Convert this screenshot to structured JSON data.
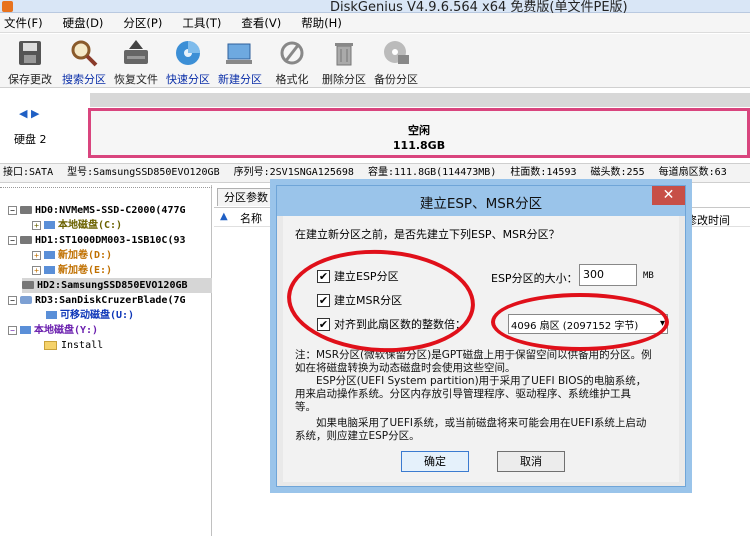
{
  "window": {
    "title": "DiskGenius V4.9.6.564 x64 免费版(单文件PE版)"
  },
  "menu": {
    "items": [
      "文件(F)",
      "硬盘(D)",
      "分区(P)",
      "工具(T)",
      "查看(V)",
      "帮助(H)"
    ]
  },
  "toolbar": {
    "items": [
      {
        "label": "保存更改",
        "icon": "save-icon"
      },
      {
        "label": "搜索分区",
        "icon": "search-icon"
      },
      {
        "label": "恢复文件",
        "icon": "recover-icon"
      },
      {
        "label": "快速分区",
        "icon": "quick-partition-icon"
      },
      {
        "label": "新建分区",
        "icon": "new-partition-icon"
      },
      {
        "label": "格式化",
        "icon": "format-icon"
      },
      {
        "label": "删除分区",
        "icon": "trash-icon"
      },
      {
        "label": "备份分区",
        "icon": "backup-icon"
      }
    ]
  },
  "disk_map": {
    "nav": "◀ ▶",
    "disk_label": "硬盘 2",
    "partition_name": "空闲",
    "partition_size": "111.8GB"
  },
  "infobar": {
    "interface": "接口:SATA",
    "model": "型号:SamsungSSD850EVO120GB",
    "serial": "序列号:2SV1SNGA125698",
    "capacity": "容量:111.8GB(114473MB)",
    "cylinders": "柱面数:14593",
    "heads": "磁头数:255",
    "sectors": "每道扇区数:63"
  },
  "tree": {
    "items": [
      {
        "expander": "−",
        "icon": "disk",
        "text": "HD0:NVMeMS-SSD-C2000(477G",
        "color": "default"
      },
      {
        "expander": "+",
        "icon": "part",
        "text": "本地磁盘(C:)",
        "color": "olive"
      },
      {
        "expander": "−",
        "icon": "disk",
        "text": "HD1:ST1000DM003-1SB10C(93",
        "color": "default"
      },
      {
        "expander": "+",
        "icon": "part",
        "text": "新加卷(D:)",
        "color": "orange"
      },
      {
        "expander": "+",
        "icon": "part",
        "text": "新加卷(E:)",
        "color": "orange"
      },
      {
        "expander": "",
        "icon": "disk",
        "text": "HD2:SamsungSSD850EVO120GB",
        "color": "default"
      },
      {
        "expander": "−",
        "icon": "usb",
        "text": "RD3:SanDiskCruzerBlade(7G",
        "color": "default"
      },
      {
        "expander": "",
        "icon": "part",
        "text": "可移动磁盘(U:)",
        "color": "blue"
      },
      {
        "expander": "−",
        "icon": "part",
        "text": "本地磁盘(Y:)",
        "color": "purple"
      },
      {
        "expander": "",
        "icon": "folder",
        "text": "Install",
        "color": "default"
      }
    ]
  },
  "right_panel": {
    "tab": "分区参数",
    "col_name": "名称",
    "col_modified": "修改时间"
  },
  "dialog": {
    "title": "建立ESP、MSR分区",
    "close": "✕",
    "question": "在建立新分区之前，是否先建立下列ESP、MSR分区？",
    "chk_esp": "建立ESP分区",
    "chk_msr": "建立MSR分区",
    "chk_align": "对齐到此扇区数的整数倍：",
    "esp_size_label": "ESP分区的大小：",
    "esp_size_value": "300",
    "esp_unit": "MB",
    "align_value": "4096 扇区 (2097152 字节)",
    "notes": [
      "注：MSR分区(微软保留分区)是GPT磁盘上用于保留空间以供备用的分区。例",
      "如在将磁盘转换为动态磁盘时会使用这些空间。",
      "　　ESP分区(UEFI System partition)用于采用了UEFI BIOS的电脑系统，",
      "用来启动操作系统。分区内存放引导管理程序、驱动程序、系统维护工具",
      "等。",
      "　　如果电脑采用了UEFI系统，或当前磁盘将来可能会用在UEFI系统上启动",
      "系统，则应建立ESP分区。"
    ],
    "ok": "确定",
    "cancel": "取消",
    "checked_mark": "✔"
  },
  "colors": {
    "annotation": "#e0101a",
    "dialog_frame": "#9ac4ea",
    "partition_border": "#d9457e"
  }
}
